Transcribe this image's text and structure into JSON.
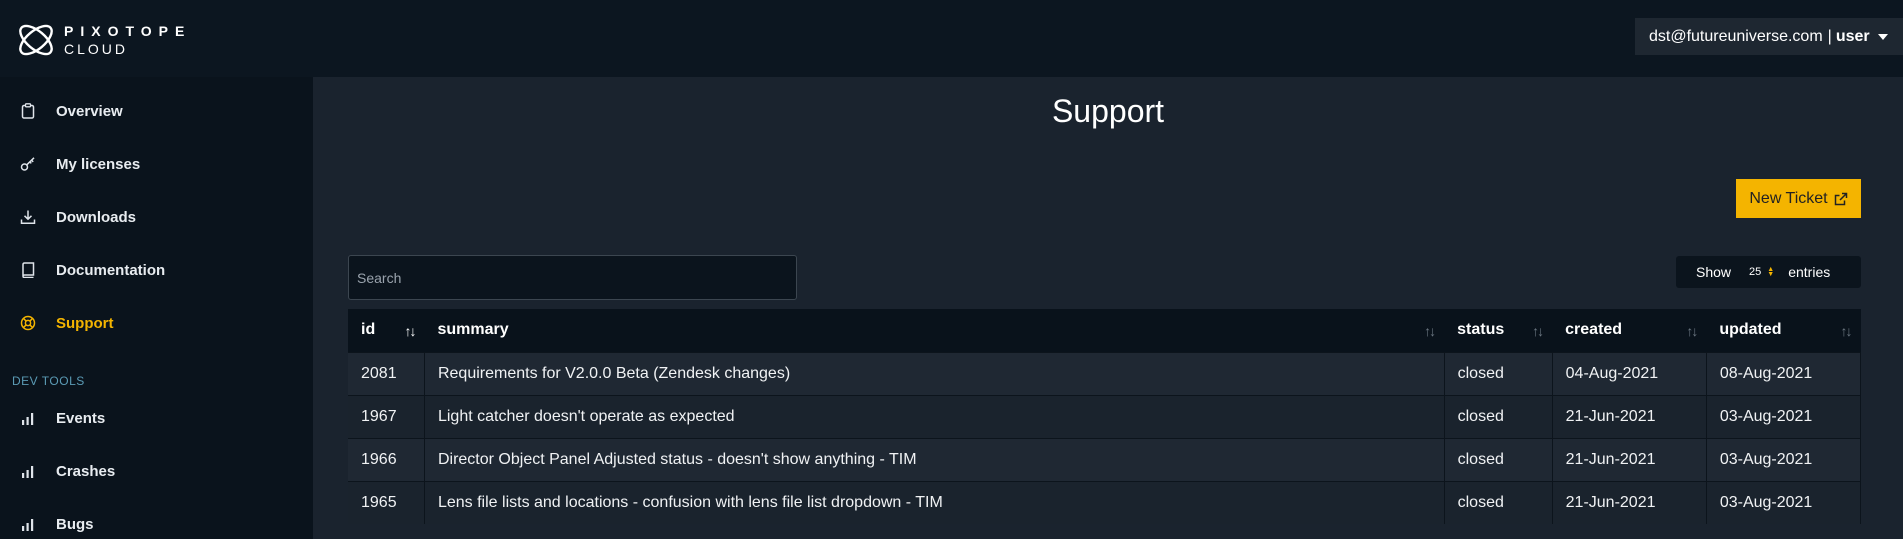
{
  "brand": {
    "line1": "PIXOTOPE",
    "line2": "CLOUD"
  },
  "user": {
    "email": "dst@futureuniverse.com",
    "separator": "|",
    "role": "user"
  },
  "sidebar": {
    "items": [
      {
        "label": "Overview",
        "icon": "clipboard-icon"
      },
      {
        "label": "My licenses",
        "icon": "key-icon"
      },
      {
        "label": "Downloads",
        "icon": "download-icon"
      },
      {
        "label": "Documentation",
        "icon": "book-icon"
      },
      {
        "label": "Support",
        "icon": "support-icon",
        "active": true
      }
    ],
    "section_label": "DEV TOOLS",
    "dev_items": [
      {
        "label": "Events",
        "icon": "bar-chart-icon"
      },
      {
        "label": "Crashes",
        "icon": "bar-chart-icon"
      },
      {
        "label": "Bugs",
        "icon": "bar-chart-icon"
      }
    ]
  },
  "main": {
    "title": "Support",
    "new_ticket_label": "New Ticket",
    "search_placeholder": "Search",
    "entries": {
      "show_label": "Show",
      "value": "25",
      "suffix": "entries"
    },
    "table": {
      "columns": [
        "id",
        "summary",
        "status",
        "created",
        "updated"
      ],
      "rows": [
        [
          "2081",
          "Requirements for V2.0.0 Beta (Zendesk changes)",
          "closed",
          "04-Aug-2021",
          "08-Aug-2021"
        ],
        [
          "1967",
          "Light catcher doesn't operate as expected",
          "closed",
          "21-Jun-2021",
          "03-Aug-2021"
        ],
        [
          "1966",
          "Director Object Panel Adjusted status - doesn't show anything - TIM",
          "closed",
          "21-Jun-2021",
          "03-Aug-2021"
        ],
        [
          "1965",
          "Lens file lists and locations - confusion with lens file list dropdown - TIM",
          "closed",
          "21-Jun-2021",
          "03-Aug-2021"
        ]
      ]
    }
  },
  "colors": {
    "accent": "#f4b400",
    "topbar": "#0c1620",
    "sidebar": "#0a131c",
    "main": "#1a232e"
  }
}
